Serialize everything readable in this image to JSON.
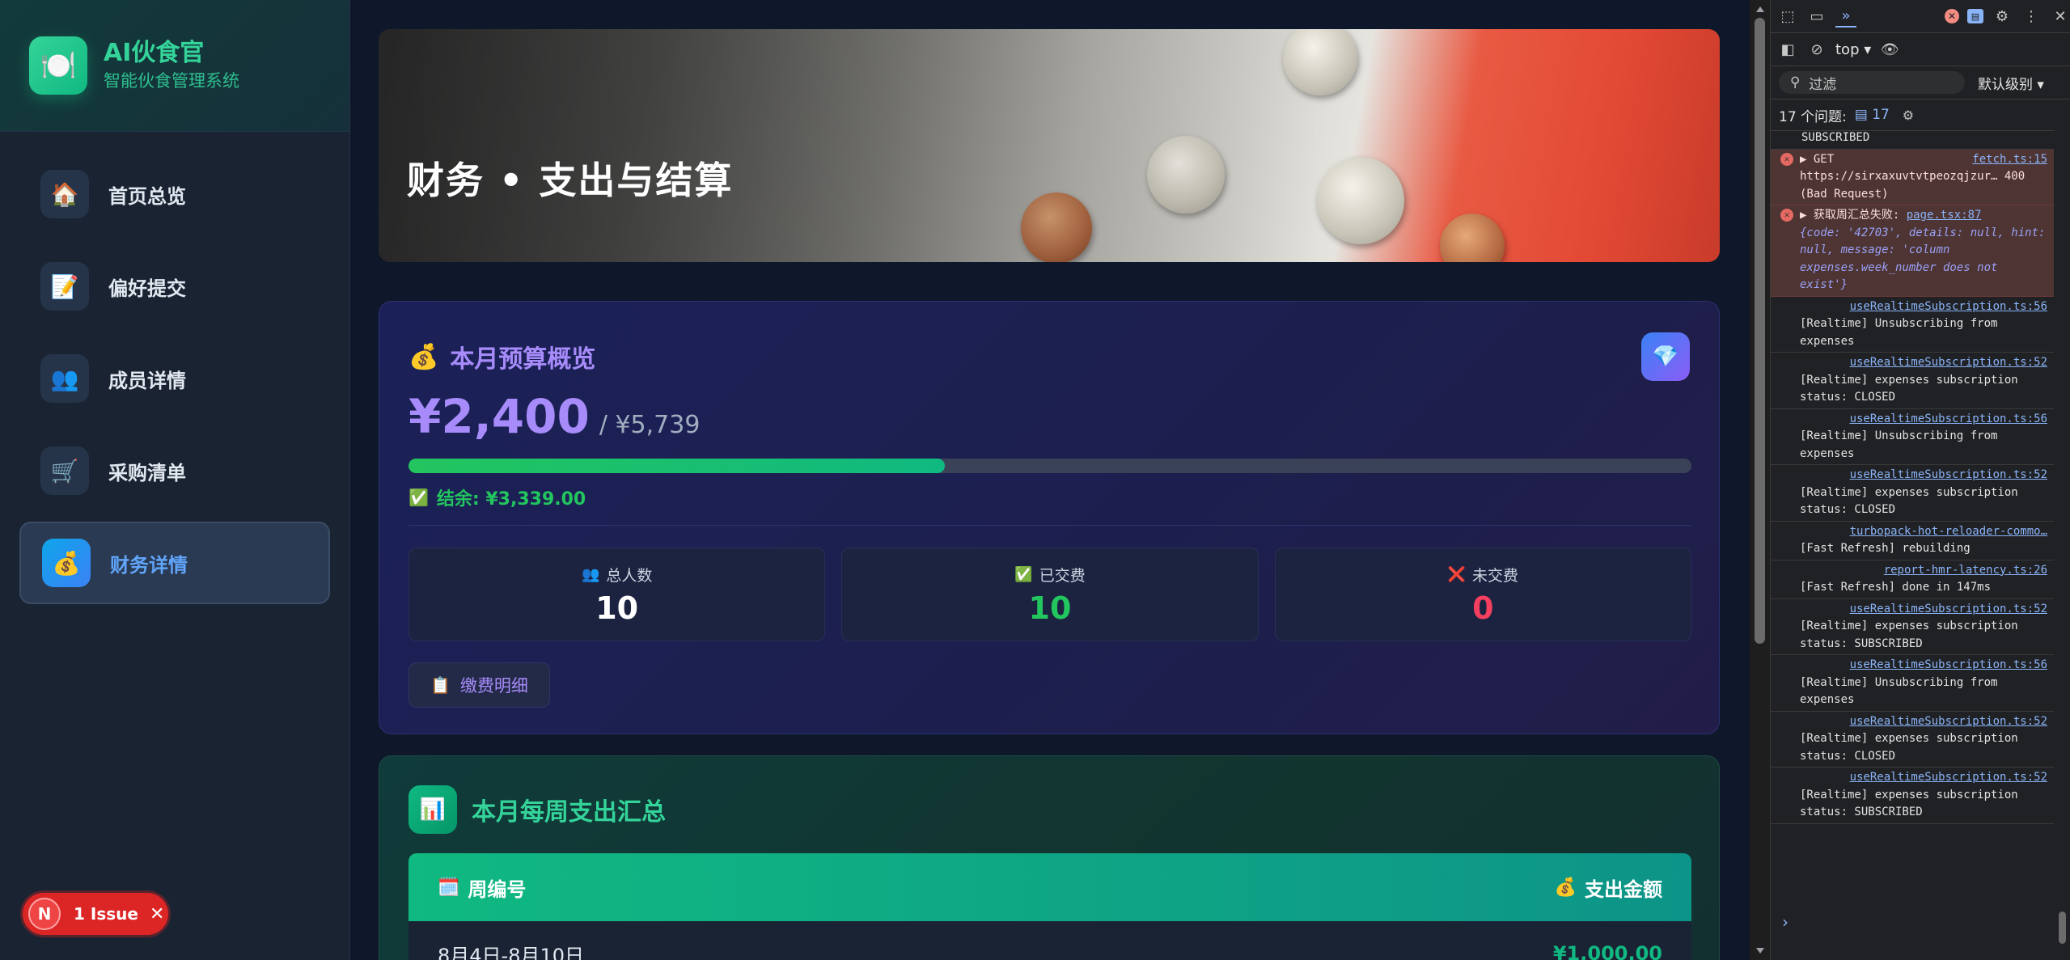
{
  "sidebar": {
    "brand": {
      "icon": "plate-icon",
      "title": "AI伙食官",
      "subtitle": "智能伙食管理系统"
    },
    "items": [
      {
        "label": "首页总览",
        "icon": "house-icon",
        "glyph": "🏠",
        "active": false
      },
      {
        "label": "偏好提交",
        "icon": "memo-icon",
        "glyph": "📝",
        "active": false
      },
      {
        "label": "成员详情",
        "icon": "people-icon",
        "glyph": "👥",
        "active": false
      },
      {
        "label": "采购清单",
        "icon": "cart-icon",
        "glyph": "🛒",
        "active": false
      },
      {
        "label": "财务详情",
        "icon": "money-bag-icon",
        "glyph": "💰",
        "active": true
      }
    ],
    "issue": {
      "letter": "N",
      "label": "1 Issue"
    }
  },
  "hero": {
    "title": "财务 • 支出与结算"
  },
  "budget": {
    "icon": "money-bag-icon",
    "title": "本月预算概览",
    "spent": "¥2,400",
    "total": "/ ¥5,739",
    "progress_fraction": 0.418,
    "remaining": "结余: ¥3,339.00",
    "stats": [
      {
        "label": "总人数",
        "icon": "people-icon",
        "glyph": "👥",
        "value": "10",
        "color": "#ffffff"
      },
      {
        "label": "已交费",
        "icon": "check-icon",
        "glyph": "✅",
        "value": "10",
        "color": "#22c55e"
      },
      {
        "label": "未交费",
        "icon": "cross-icon",
        "glyph": "❌",
        "value": "0",
        "color": "#f43f5e"
      }
    ],
    "detail_button": "缴费明细"
  },
  "weekly": {
    "title": "本月每周支出汇总",
    "col_week": "周编号",
    "col_amount": "支出金额",
    "rows": [
      {
        "week": "8月4日-8月10日",
        "amount": "¥1,000.00"
      }
    ]
  },
  "devtools": {
    "context": "top",
    "filter_placeholder": "过滤",
    "level": "默认级别",
    "issues_label": "17 个问题:",
    "issues_count": "17",
    "error_count": "",
    "message_count": "",
    "console": [
      {
        "type": "plain",
        "text": "SUBSCRIBED"
      },
      {
        "type": "err",
        "prefix": "▶ GET",
        "src": "fetch.ts:15",
        "text": "https://sirxaxuvtvtpeozqjzur… 400 (Bad Request)"
      },
      {
        "type": "err",
        "prefix": "▶ 获取周汇总失败:",
        "src": "page.tsx:87",
        "text": "{code: '42703', details: null, hint: null, message: 'column expenses.week_number does not exist'}"
      },
      {
        "type": "log",
        "src": "useRealtimeSubscription.ts:56",
        "text": "[Realtime] Unsubscribing from expenses"
      },
      {
        "type": "log",
        "src": "useRealtimeSubscription.ts:52",
        "text": "[Realtime] expenses subscription status: CLOSED"
      },
      {
        "type": "log",
        "src": "useRealtimeSubscription.ts:56",
        "text": "[Realtime] Unsubscribing from expenses"
      },
      {
        "type": "log",
        "src": "useRealtimeSubscription.ts:52",
        "text": "[Realtime] expenses subscription status: CLOSED"
      },
      {
        "type": "log",
        "src": "turbopack-hot-reloader-commo…",
        "text": "[Fast Refresh] rebuilding"
      },
      {
        "type": "log",
        "src": "report-hmr-latency.ts:26",
        "text": "[Fast Refresh] done in 147ms"
      },
      {
        "type": "log",
        "src": "useRealtimeSubscription.ts:52",
        "text": "[Realtime] expenses subscription status: SUBSCRIBED"
      },
      {
        "type": "log",
        "src": "useRealtimeSubscription.ts:56",
        "text": "[Realtime] Unsubscribing from expenses"
      },
      {
        "type": "log",
        "src": "useRealtimeSubscription.ts:52",
        "text": "[Realtime] expenses subscription status: CLOSED"
      },
      {
        "type": "log",
        "src": "useRealtimeSubscription.ts:52",
        "text": "[Realtime] expenses subscription status: SUBSCRIBED"
      }
    ]
  }
}
